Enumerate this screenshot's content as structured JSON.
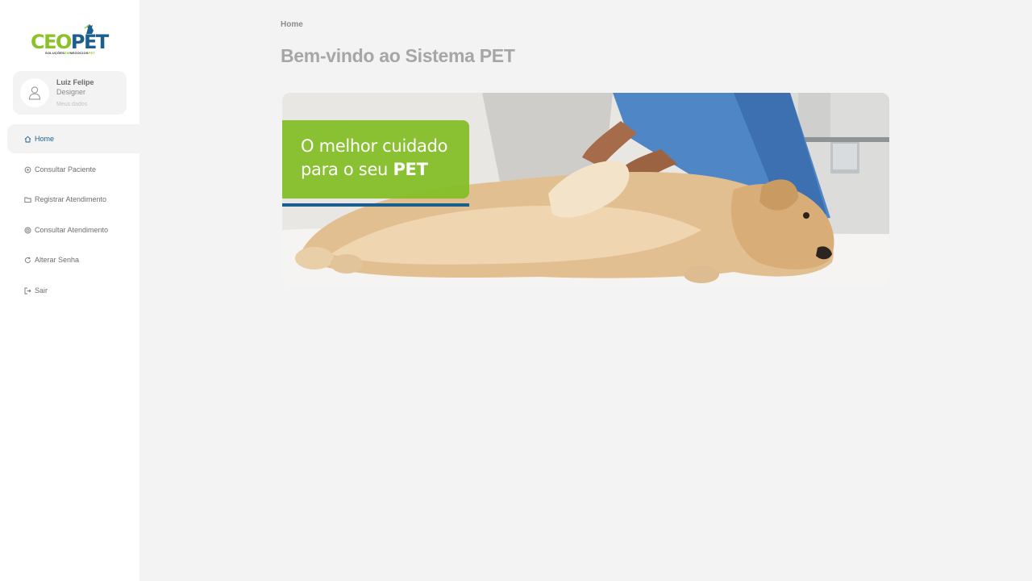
{
  "logo": {
    "ceo": "CEO",
    "pet": "PET",
    "tag_a": "SOLUÇÕES",
    "tag_b": "EM",
    "tag_c": "NEGÓCIOS",
    "tag_d": "PET"
  },
  "user": {
    "name": "Luiz Felipe",
    "role": "Designer",
    "link": "Meus dados",
    "avatar_icon": "user-icon"
  },
  "nav": {
    "items": [
      {
        "label": "Home",
        "icon": "home-icon",
        "active": true
      },
      {
        "label": "Consultar Paciente",
        "icon": "paw-icon"
      },
      {
        "label": "Registrar Atendimento",
        "icon": "folder-icon"
      },
      {
        "label": "Consultar Atendimento",
        "icon": "target-icon"
      },
      {
        "label": "Alterar Senha",
        "icon": "refresh-icon"
      },
      {
        "label": "Sair",
        "icon": "logout-icon"
      }
    ]
  },
  "breadcrumb": "Home",
  "page_title": "Bem-vindo ao Sistema PET",
  "banner": {
    "line1": "O melhor cuidado",
    "line2_prefix": "para o seu ",
    "line2_bold": "PET"
  },
  "colors": {
    "accent": "#1b5f8e",
    "brand_green": "#8bc228",
    "background": "#f3f3f3"
  }
}
